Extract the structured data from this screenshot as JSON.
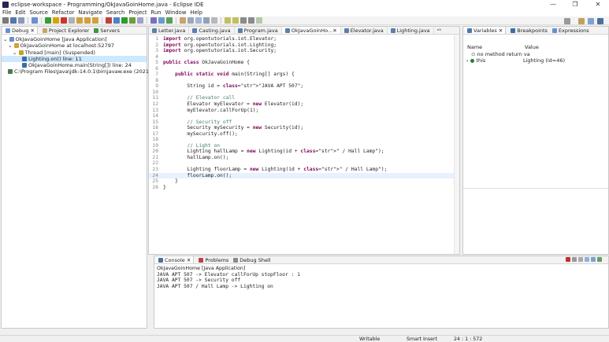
{
  "window": {
    "title": "eclipse-workspace - Programming/OkJavaGoinHome.java - Eclipse IDE",
    "minimize": "—",
    "maximize": "❐",
    "close": "✕"
  },
  "menubar": [
    "File",
    "Edit",
    "Source",
    "Refactor",
    "Navigate",
    "Search",
    "Project",
    "Run",
    "Window",
    "Help"
  ],
  "debug_view": {
    "tabs": [
      "Debug",
      "Project Explorer",
      "Servers"
    ],
    "tree": [
      "OkJavaGoinHome [Java Application]",
      "OkJavaGoinHome at localhost:52797",
      "Thread [main] (Suspended)",
      "Lighting.on() line: 11",
      "OkJavaGoinHome.main(String[]) line: 24",
      "C:\\Program Files\\Java\\jdk-14.0.1\\bin\\javaw.exe  (2021. 1. 2"
    ]
  },
  "editor": {
    "tabs": [
      "Letter.java",
      "Casting.java",
      "Program.java",
      "OkJavaGoinHo...",
      "Elevator.java",
      "Lighting.java",
      "ⁿ⁵"
    ],
    "lines": [
      {
        "n": "1",
        "text": "import org.opentutorials.iot.Elevator;"
      },
      {
        "n": "2",
        "text": "import org.opentutorials.iot.Lighting;"
      },
      {
        "n": "3",
        "text": "import org.opentutorials.iot.Security;"
      },
      {
        "n": "4",
        "text": ""
      },
      {
        "n": "5",
        "text": "public class OkJavaGoinHome {"
      },
      {
        "n": "6",
        "text": ""
      },
      {
        "n": "7",
        "text": "    public static void main(String[] args) {"
      },
      {
        "n": "8",
        "text": ""
      },
      {
        "n": "9",
        "text": "        String id = \"JAVA APT 507\";"
      },
      {
        "n": "10",
        "text": ""
      },
      {
        "n": "11",
        "text": "        // Elevator call"
      },
      {
        "n": "12",
        "text": "        Elevator myElevator = new Elevator(id);"
      },
      {
        "n": "13",
        "text": "        myElevator.callForUp(1);"
      },
      {
        "n": "14",
        "text": ""
      },
      {
        "n": "15",
        "text": "        // Security off"
      },
      {
        "n": "16",
        "text": "        Security mySecurity = new Security(id);"
      },
      {
        "n": "17",
        "text": "        mySecurity.off();"
      },
      {
        "n": "18",
        "text": ""
      },
      {
        "n": "19",
        "text": "        // Light on"
      },
      {
        "n": "20",
        "text": "        Lighting hallLamp = new Lighting(id + \" / Hall Lamp\");"
      },
      {
        "n": "21",
        "text": "        hallLamp.on();"
      },
      {
        "n": "22",
        "text": ""
      },
      {
        "n": "23",
        "text": "        Lighting floorLamp = new Lighting(id + \" / Hall Lamp\");"
      },
      {
        "n": "24",
        "text": "        floorLamp.on();"
      },
      {
        "n": "25",
        "text": "    }"
      },
      {
        "n": "26",
        "text": "}"
      }
    ]
  },
  "variables_view": {
    "tabs": [
      "Variables",
      "Breakpoints",
      "Expressions"
    ],
    "columns": [
      "Name",
      "Value"
    ],
    "rows": [
      {
        "name": "no method return va",
        "value": ""
      },
      {
        "name": "this",
        "value": "Lighting  (id=46)"
      }
    ]
  },
  "console_view": {
    "tabs": [
      "Console",
      "Problems",
      "Debug Shell"
    ],
    "title": "OkJavaGoinHome [Java Application]",
    "output": [
      "JAVA APT 507 -> Elevator callForUp stopFloor : 1",
      "JAVA APT 507 -> Security off",
      "JAVA APT 507 / Hall Lamp -> Lighting on"
    ]
  },
  "statusbar": {
    "mode": "Writable",
    "insert": "Smart Insert",
    "position": "24 : 1 : 572"
  },
  "colors": {
    "keyword": "#7f0055",
    "string": "#2a00ff",
    "comment": "#3f7f5f",
    "selection": "#cde8ff"
  }
}
